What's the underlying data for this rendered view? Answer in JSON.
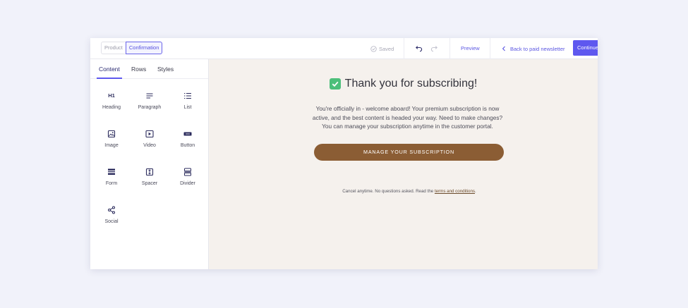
{
  "topbar": {
    "page_switch": [
      "Product",
      "Confirmation"
    ],
    "active_page": "Confirmation",
    "status": "Saved",
    "preview_label": "Preview",
    "back_label": "Back to paid newsletter",
    "continue_label": "Continue"
  },
  "sidebar": {
    "tabs": [
      "Content",
      "Rows",
      "Styles"
    ],
    "active_tab": "Content",
    "tools": [
      {
        "label": "Heading",
        "icon": "h1-icon"
      },
      {
        "label": "Paragraph",
        "icon": "paragraph-icon"
      },
      {
        "label": "List",
        "icon": "list-icon"
      },
      {
        "label": "Image",
        "icon": "image-icon"
      },
      {
        "label": "Video",
        "icon": "video-icon"
      },
      {
        "label": "Button",
        "icon": "button-icon"
      },
      {
        "label": "Form",
        "icon": "form-icon"
      },
      {
        "label": "Spacer",
        "icon": "spacer-icon"
      },
      {
        "label": "Divider",
        "icon": "divider-icon"
      },
      {
        "label": "Social",
        "icon": "share-icon"
      }
    ],
    "heading_icon_text": "H1"
  },
  "canvas": {
    "title": "Thank you for subscribing!",
    "body": "You're officially in - welcome aboard! Your premium subscription is now active, and the best content is headed your way. Need to make changes? You can manage your subscription anytime in the customer portal.",
    "button_label": "MANAGE YOUR SUBSCRIPTION",
    "footnote_prefix": "Cancel anytime. No questions asked. Read the",
    "footnote_link": "terms and conditions",
    "footnote_suffix": "."
  },
  "colors": {
    "accent": "#5e58ef",
    "page_background": "#f1f2fa",
    "canvas_background": "#f5f1ed",
    "manage_button": "#8b5d34",
    "check_green": "#4cbf7a"
  }
}
